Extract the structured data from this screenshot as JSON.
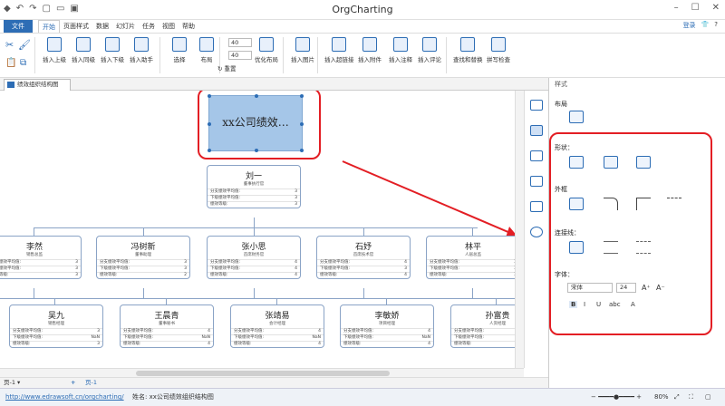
{
  "app": {
    "title": "OrgCharting",
    "login": "登录",
    "file_menu": "文件",
    "tabs": [
      "开始",
      "页面样式",
      "数据",
      "幻灯片",
      "任务",
      "视图",
      "帮助"
    ]
  },
  "ribbon": {
    "buttons": [
      "插入上级",
      "插入同级",
      "插入下级",
      "插入助手",
      "选择",
      "布局",
      "优化布局",
      "插入图片",
      "插入超链接",
      "插入附件",
      "插入注释",
      "插入评论",
      "查找和替换",
      "拼写检查"
    ],
    "spin1": "40",
    "spin2": "40",
    "reset": "重置"
  },
  "doc_tab": "绩效组织结构图",
  "canvas": {
    "selected_text": "xx公司绩效…",
    "root": {
      "name": "刘一",
      "role": "董事执行官",
      "rows": [
        [
          "分支绩效平均值:",
          "3"
        ],
        [
          "下级绩效平均值:",
          "3"
        ],
        [
          "绩效等级:",
          "3"
        ]
      ]
    },
    "level2": [
      {
        "name": "李然",
        "role": "销售总监",
        "rows": [
          [
            "分支绩效平均值:",
            "3"
          ],
          [
            "下级绩效平均值:",
            "3"
          ],
          [
            "绩效等级:",
            "3"
          ]
        ]
      },
      {
        "name": "冯树新",
        "role": "董事助理",
        "rows": [
          [
            "分支绩效平均值:",
            "3"
          ],
          [
            "下级绩效平均值:",
            "3"
          ],
          [
            "绩效等级:",
            "2"
          ]
        ]
      },
      {
        "name": "张小思",
        "role": "首席财务官",
        "rows": [
          [
            "分支绩效平均值:",
            "4"
          ],
          [
            "下级绩效平均值:",
            "4"
          ],
          [
            "绩效等级:",
            "4"
          ]
        ]
      },
      {
        "name": "石妤",
        "role": "首席技术官",
        "rows": [
          [
            "分支绩效平均值:",
            "4"
          ],
          [
            "下级绩效平均值:",
            "3"
          ],
          [
            "绩效等级:",
            "4"
          ]
        ]
      },
      {
        "name": "林平",
        "role": "人居总监",
        "rows": [
          [
            "分支绩效平均值:",
            "3"
          ],
          [
            "下级绩效平均值:",
            "3"
          ],
          [
            "绩效等级:",
            "3"
          ]
        ]
      }
    ],
    "level3": [
      {
        "name": "吴九",
        "role": "销售经理",
        "rows": [
          [
            "分支绩效平均值:",
            "3"
          ],
          [
            "下级绩效平均值:",
            "NaN"
          ],
          [
            "绩效等级:",
            "3"
          ]
        ]
      },
      {
        "name": "王晨青",
        "role": "董事秘书",
        "rows": [
          [
            "分支绩效平均值:",
            "4"
          ],
          [
            "下级绩效平均值:",
            "NaN"
          ],
          [
            "绩效等级:",
            "4"
          ]
        ]
      },
      {
        "name": "张靖易",
        "role": "会计经理",
        "rows": [
          [
            "分支绩效平均值:",
            "4"
          ],
          [
            "下级绩效平均值:",
            "NaN"
          ],
          [
            "绩效等级:",
            "4"
          ]
        ]
      },
      {
        "name": "李敏娇",
        "role": "项目经理",
        "rows": [
          [
            "分支绩效平均值:",
            "4"
          ],
          [
            "下级绩效平均值:",
            "NaN"
          ],
          [
            "绩效等级:",
            "4"
          ]
        ]
      },
      {
        "name": "孙富贵",
        "role": "人资经理",
        "rows": [
          [
            "分支绩效平均值:",
            "3"
          ],
          [
            "下级绩效平均值:",
            "NaN"
          ],
          [
            "绩效等级:",
            "3"
          ]
        ]
      }
    ]
  },
  "page_bar": {
    "page_select": "页-1",
    "current_page": "页-1"
  },
  "status": {
    "url": "http://www.edrawsoft.cn/orgcharting/",
    "name": "姓名: xx公司绩效组织结构图",
    "zoom": "80%"
  },
  "panel": {
    "title": "样式",
    "layout_label": "布局",
    "shape_label": "形状：",
    "outline_label": "外框",
    "connector_label": "连接线：",
    "font_label": "字体：",
    "font_name": "宋体",
    "font_size": "24",
    "font_buttons": [
      "B",
      "I",
      "U",
      "abc",
      "A"
    ]
  },
  "colors": {
    "accent": "#2d6db5",
    "highlight": "#e31e24",
    "selected_fill": "#a5c6e8"
  }
}
